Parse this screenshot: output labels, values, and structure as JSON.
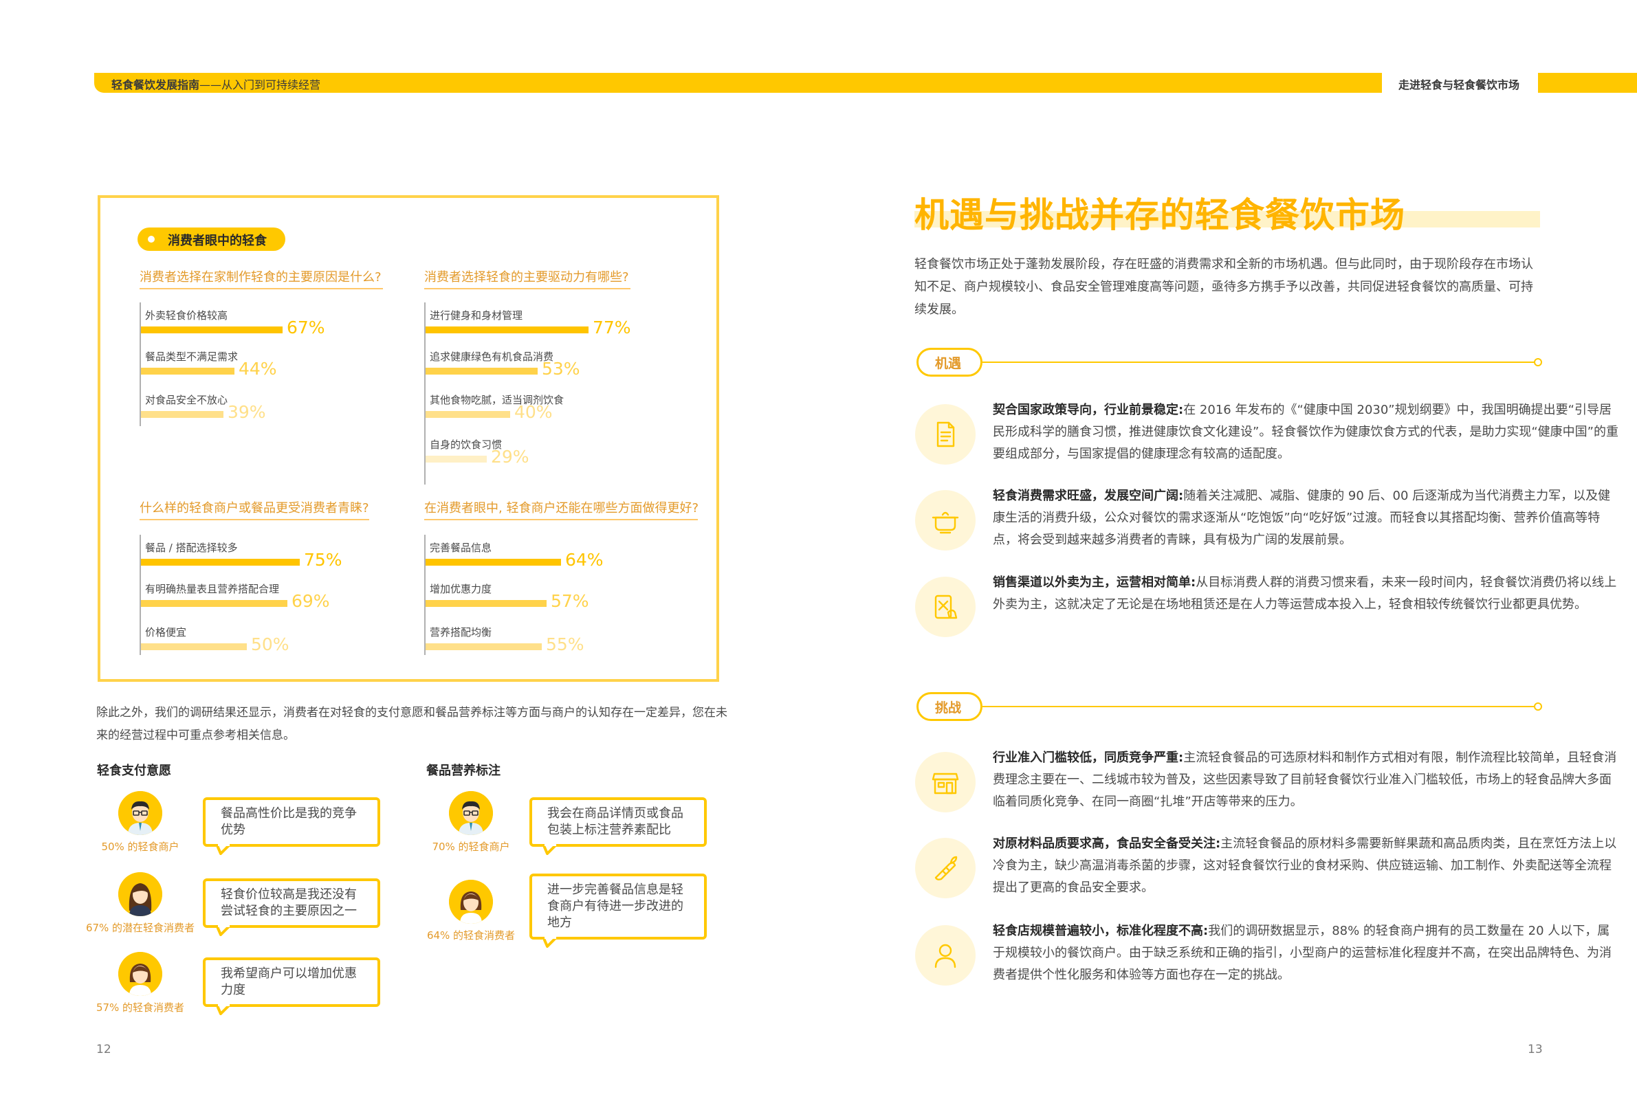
{
  "header": {
    "left_bold": "轻食餐饮发展指南",
    "left_rest": "——从入门到可持续经营",
    "right": "走进轻食与轻食餐饮市场"
  },
  "survey": {
    "pill": "消费者眼中的轻食",
    "panels": [
      {
        "question": "消费者选择在家制作轻食的主要原因是什么?",
        "items": [
          {
            "label": "外卖轻食价格较高",
            "value": 67,
            "value_text": "67%"
          },
          {
            "label": "餐品类型不满足需求",
            "value": 44,
            "value_text": "44%"
          },
          {
            "label": "对食品安全不放心",
            "value": 39,
            "value_text": "39%"
          }
        ]
      },
      {
        "question": "消费者选择轻食的主要驱动力有哪些?",
        "items": [
          {
            "label": "进行健身和身材管理",
            "value": 77,
            "value_text": "77%"
          },
          {
            "label": "追求健康绿色有机食品消费",
            "value": 53,
            "value_text": "53%"
          },
          {
            "label": "其他食物吃腻，适当调剂饮食",
            "value": 40,
            "value_text": "40%"
          },
          {
            "label": "自身的饮食习惯",
            "value": 29,
            "value_text": "29%"
          }
        ]
      },
      {
        "question": "什么样的轻食商户或餐品更受消费者青睐?",
        "items": [
          {
            "label": "餐品 / 搭配选择较多",
            "value": 75,
            "value_text": "75%"
          },
          {
            "label": "有明确热量表且营养搭配合理",
            "value": 69,
            "value_text": "69%"
          },
          {
            "label": "价格便宜",
            "value": 50,
            "value_text": "50%"
          }
        ]
      },
      {
        "question": "在消费者眼中, 轻食商户还能在哪些方面做得更好?",
        "items": [
          {
            "label": "完善餐品信息",
            "value": 64,
            "value_text": "64%"
          },
          {
            "label": "增加优惠力度",
            "value": 57,
            "value_text": "57%"
          },
          {
            "label": "营养搭配均衡",
            "value": 55,
            "value_text": "55%"
          }
        ]
      }
    ]
  },
  "left_paragraph": "除此之外，我们的调研结果还显示，消费者在对轻食的支付意愿和餐品营养标注等方面与商户的认知存在一定差异，您在未来的经营过程中可重点参考相关信息。",
  "payment": {
    "title": "轻食支付意愿",
    "rows": [
      {
        "caption": "50% 的轻食商户",
        "quote": "餐品高性价比是我的竞争优势",
        "avatar": "male-glasses-avatar"
      },
      {
        "caption": "67% 的潜在轻食消费者",
        "quote": "轻食价位较高是我还没有尝试轻食的主要原因之一",
        "avatar": "female-long-hair-avatar"
      },
      {
        "caption": "57% 的轻食消费者",
        "quote": "我希望商户可以增加优惠力度",
        "avatar": "female-short-hair-avatar"
      }
    ]
  },
  "nutrition": {
    "title": "餐品营养标注",
    "rows": [
      {
        "caption": "70% 的轻食商户",
        "quote": "我会在商品详情页或食品包装上标注营养素配比",
        "avatar": "male-glasses-avatar"
      },
      {
        "caption": "64% 的轻食消费者",
        "quote": "进一步完善餐品信息是轻食商户有待进一步改进的地方",
        "avatar": "female-short-hair-avatar"
      }
    ]
  },
  "right_page": {
    "title": "机遇与挑战并存的轻食餐饮市场",
    "intro": "轻食餐饮市场正处于蓬勃发展阶段，存在旺盛的消费需求和全新的市场机遇。但与此同时，由于现阶段存在市场认知不足、商户规模较小、食品安全管理难度高等问题，亟待多方携手予以改善，共同促进轻食餐饮的高质量、可持续发展。",
    "opportunity_label": "机遇",
    "opportunities": [
      {
        "icon": "document-icon",
        "head": "契合国家政策导向，行业前景稳定:",
        "body": "在 2016 年发布的《“健康中国 2030”规划纲要》中，我国明确提出要“引导居民形成科学的膳食习惯，推进健康饮食文化建设”。轻食餐饮作为健康饮食方式的代表，是助力实现“健康中国”的重要组成部分，与国家提倡的健康理念有较高的适配度。"
      },
      {
        "icon": "cooking-pot-icon",
        "head": "轻食消费需求旺盛，发展空间广阔:",
        "body": "随着关注减肥、减脂、健康的 90 后、00 后逐渐成为当代消费主力军，以及健康生活的消费升级，公众对餐饮的需求逐渐从“吃饱饭”向“吃好饭”过渡。而轻食以其搭配均衡、营养价值高等特点，将会受到越来越多消费者的青睐，具有极为广阔的发展前景。"
      },
      {
        "icon": "mobile-order-icon",
        "head": "销售渠道以外卖为主，运营相对简单:",
        "body": "从目标消费人群的消费习惯来看，未来一段时间内，轻食餐饮消费仍将以线上外卖为主，这就决定了无论是在场地租赁还是在人力等运营成本投入上，轻食相较传统餐饮行业都更具优势。"
      }
    ],
    "challenge_label": "挑战",
    "challenges": [
      {
        "icon": "storefront-icon",
        "head": "行业准入门槛较低，同质竞争严重:",
        "body": "主流轻食餐品的可选原材料和制作方式相对有限，制作流程比较简单，且轻食消费理念主要在一、二线城市较为普及，这些因素导致了目前轻食餐饮行业准入门槛较低，市场上的轻食品牌大多面临着同质化竞争、在同一商圈“扎堆”开店等带来的压力。"
      },
      {
        "icon": "vegetable-icon",
        "head": "对原材料品质要求高，食品安全备受关注:",
        "body": "主流轻食餐品的原材料多需要新鲜果蔬和高品质肉类，且在烹饪方法上以冷食为主，缺少高温消毒杀菌的步骤，这对轻食餐饮行业的食材采购、供应链运输、加工制作、外卖配送等全流程提出了更高的食品安全要求。"
      },
      {
        "icon": "person-icon",
        "head": "轻食店规模普遍较小，标准化程度不高:",
        "body": "我们的调研数据显示，88% 的轻食商户拥有的员工数量在 20 人以下，属于规模较小的餐饮商户。由于缺乏系统和正确的指引，小型商户的运营标准化程度并不高，在突出品牌特色、为消费者提供个性化服务和体验等方面也存在一定的挑战。"
      }
    ]
  },
  "page_numbers": {
    "left": "12",
    "right": "13"
  },
  "colors": {
    "accent": "#ffc800",
    "accent_text": "#e39a2a",
    "bar_1": "#ffc400",
    "bar_2": "#ffd24a",
    "bar_3": "#ffe08a",
    "bar_4": "#fff0c6"
  }
}
